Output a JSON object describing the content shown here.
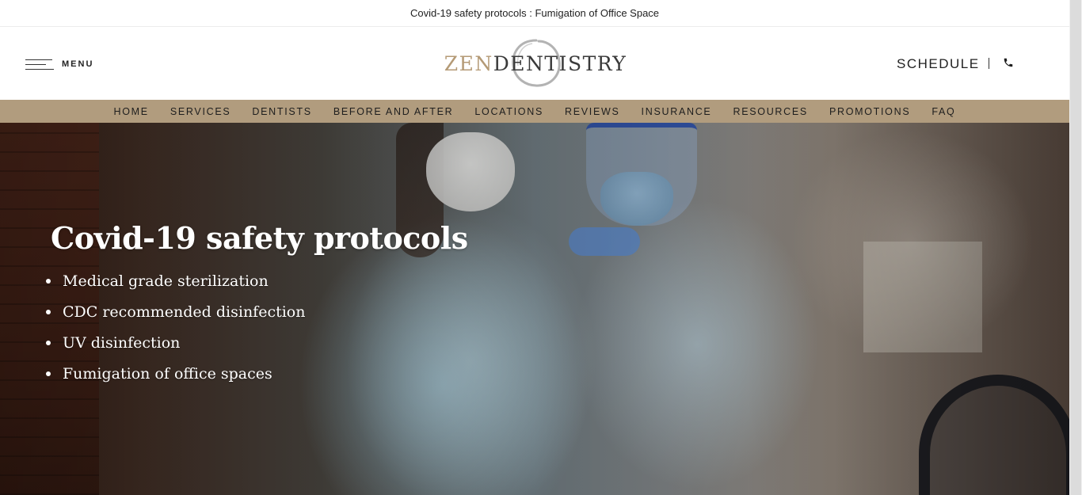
{
  "announcement": {
    "text": "Covid-19 safety protocols : Fumigation of Office Space"
  },
  "header": {
    "menu_label": "MENU",
    "logo": {
      "part1": "ZEN",
      "part2": "DENTISTRY"
    },
    "schedule_label": "SCHEDULE",
    "phone_icon": "phone-icon"
  },
  "nav": {
    "items": [
      "HOME",
      "SERVICES",
      "DENTISTS",
      "BEFORE AND AFTER",
      "LOCATIONS",
      "REVIEWS",
      "INSURANCE",
      "RESOURCES",
      "PROMOTIONS",
      "FAQ"
    ]
  },
  "hero": {
    "title": "Covid-19 safety protocols",
    "bullets": [
      "Medical grade sterilization",
      "CDC recommended disinfection",
      "UV disinfection",
      "Fumigation of office spaces"
    ]
  },
  "colors": {
    "brand_gold": "#b49a76",
    "nav_background": "#b19c7e",
    "text_dark": "#222222"
  }
}
